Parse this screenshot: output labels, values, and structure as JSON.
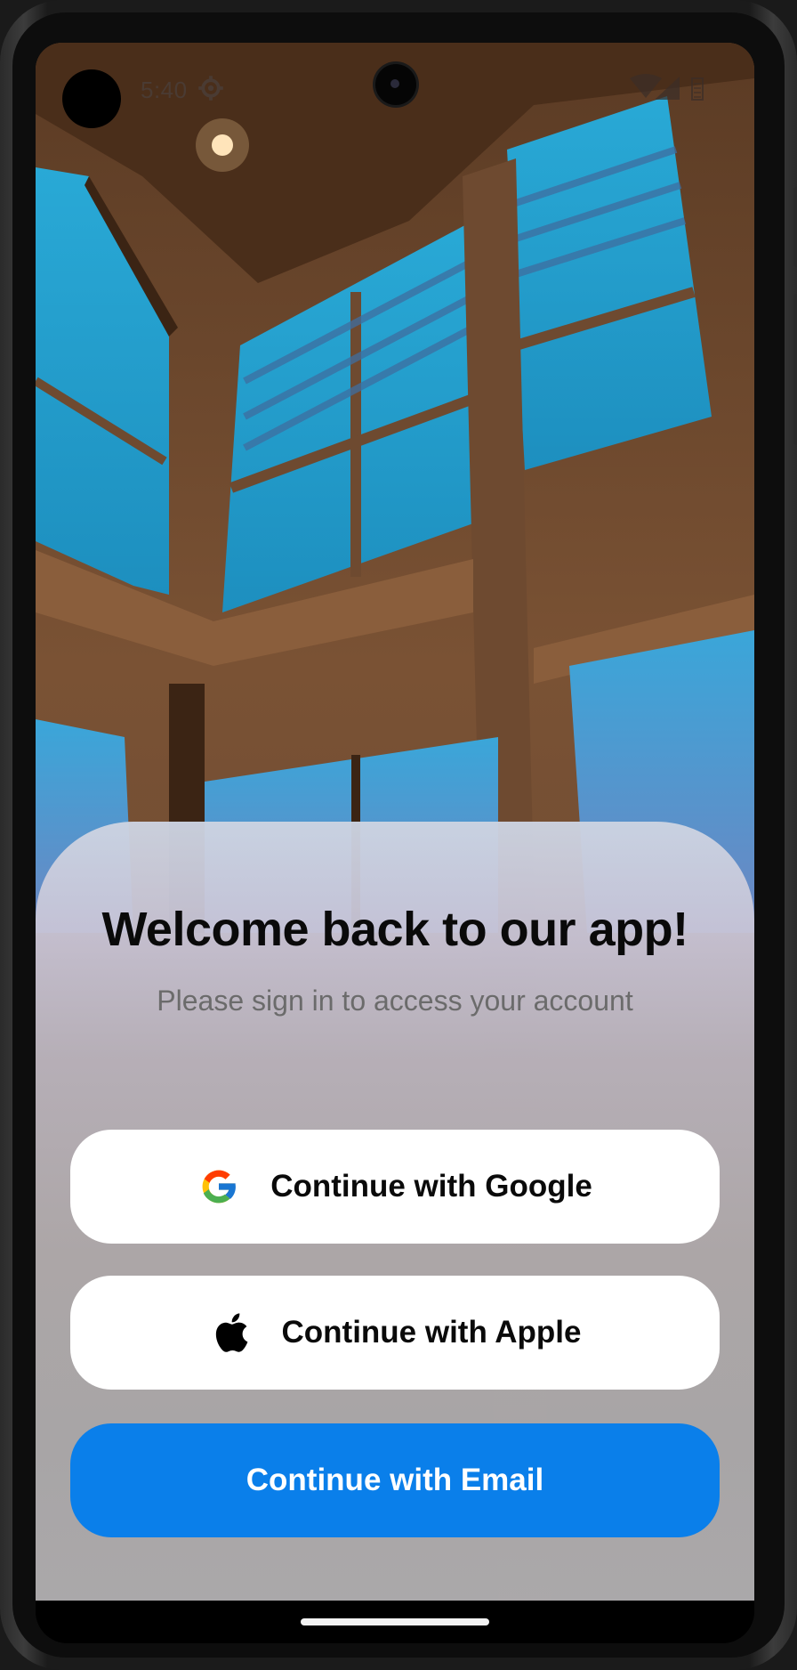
{
  "status_bar": {
    "time": "5:40",
    "settings_icon": "gear-icon",
    "wifi_icon": "wifi-icon",
    "signal_icon": "signal-icon",
    "battery_icon": "battery-icon"
  },
  "login_sheet": {
    "title": "Welcome back to our app!",
    "subtitle": "Please sign in to access your account",
    "google_button": {
      "label": "Continue with Google",
      "icon": "google-icon"
    },
    "apple_button": {
      "label": "Continue with Apple",
      "icon": "apple-icon"
    },
    "email_button": {
      "label": "Continue with Email"
    }
  },
  "colors": {
    "email_button_bg": "#0a7fea",
    "social_button_bg": "#ffffff",
    "title_text": "#0a0a0a",
    "subtitle_text": "#6b6b6b"
  }
}
